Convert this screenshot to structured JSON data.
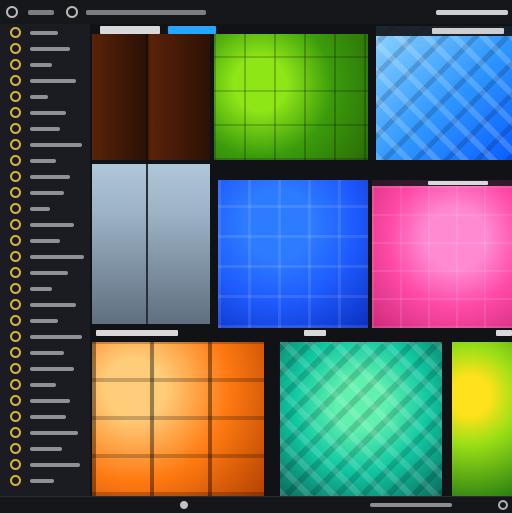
{
  "app": {
    "title": "",
    "top_labels": [],
    "status_text": ""
  },
  "sidebar": {
    "items_count_visible": 30,
    "icon_name": "folder-icon"
  },
  "textures": [
    {
      "id": "brown-panel",
      "colors": [
        "#5a2208",
        "#2b1106",
        "#5a2208"
      ]
    },
    {
      "id": "green-cubes",
      "colors": [
        "#3b9b0c",
        "#8fe617",
        "#2a6b07"
      ]
    },
    {
      "id": "blue-blocks",
      "colors": [
        "#2e96ff",
        "#8fd4ff",
        "#0a5cff"
      ]
    },
    {
      "id": "gray-panel",
      "colors": [
        "#b0c6d9",
        "#5f6f7f",
        "#9db3c6"
      ]
    },
    {
      "id": "blue-grid",
      "colors": [
        "#1f5cff",
        "#2d7bff",
        "#0b2fbf"
      ]
    },
    {
      "id": "pink-tiles",
      "colors": [
        "#ff4aa6",
        "#ff8ad1",
        "#cc2a7a"
      ]
    },
    {
      "id": "orange-capsules",
      "colors": [
        "#ff7a12",
        "#ffcc7a",
        "#b34100"
      ]
    },
    {
      "id": "teal-scales",
      "colors": [
        "#11c7a2",
        "#61f0ae",
        "#0b6a5c"
      ]
    },
    {
      "id": "lime-blobs",
      "colors": [
        "#9adf16",
        "#ffe21b",
        "#2a7f13"
      ]
    }
  ],
  "colors": {
    "accent_folder": "#d8b531",
    "accent_blue_tab": "#27a6ff"
  }
}
